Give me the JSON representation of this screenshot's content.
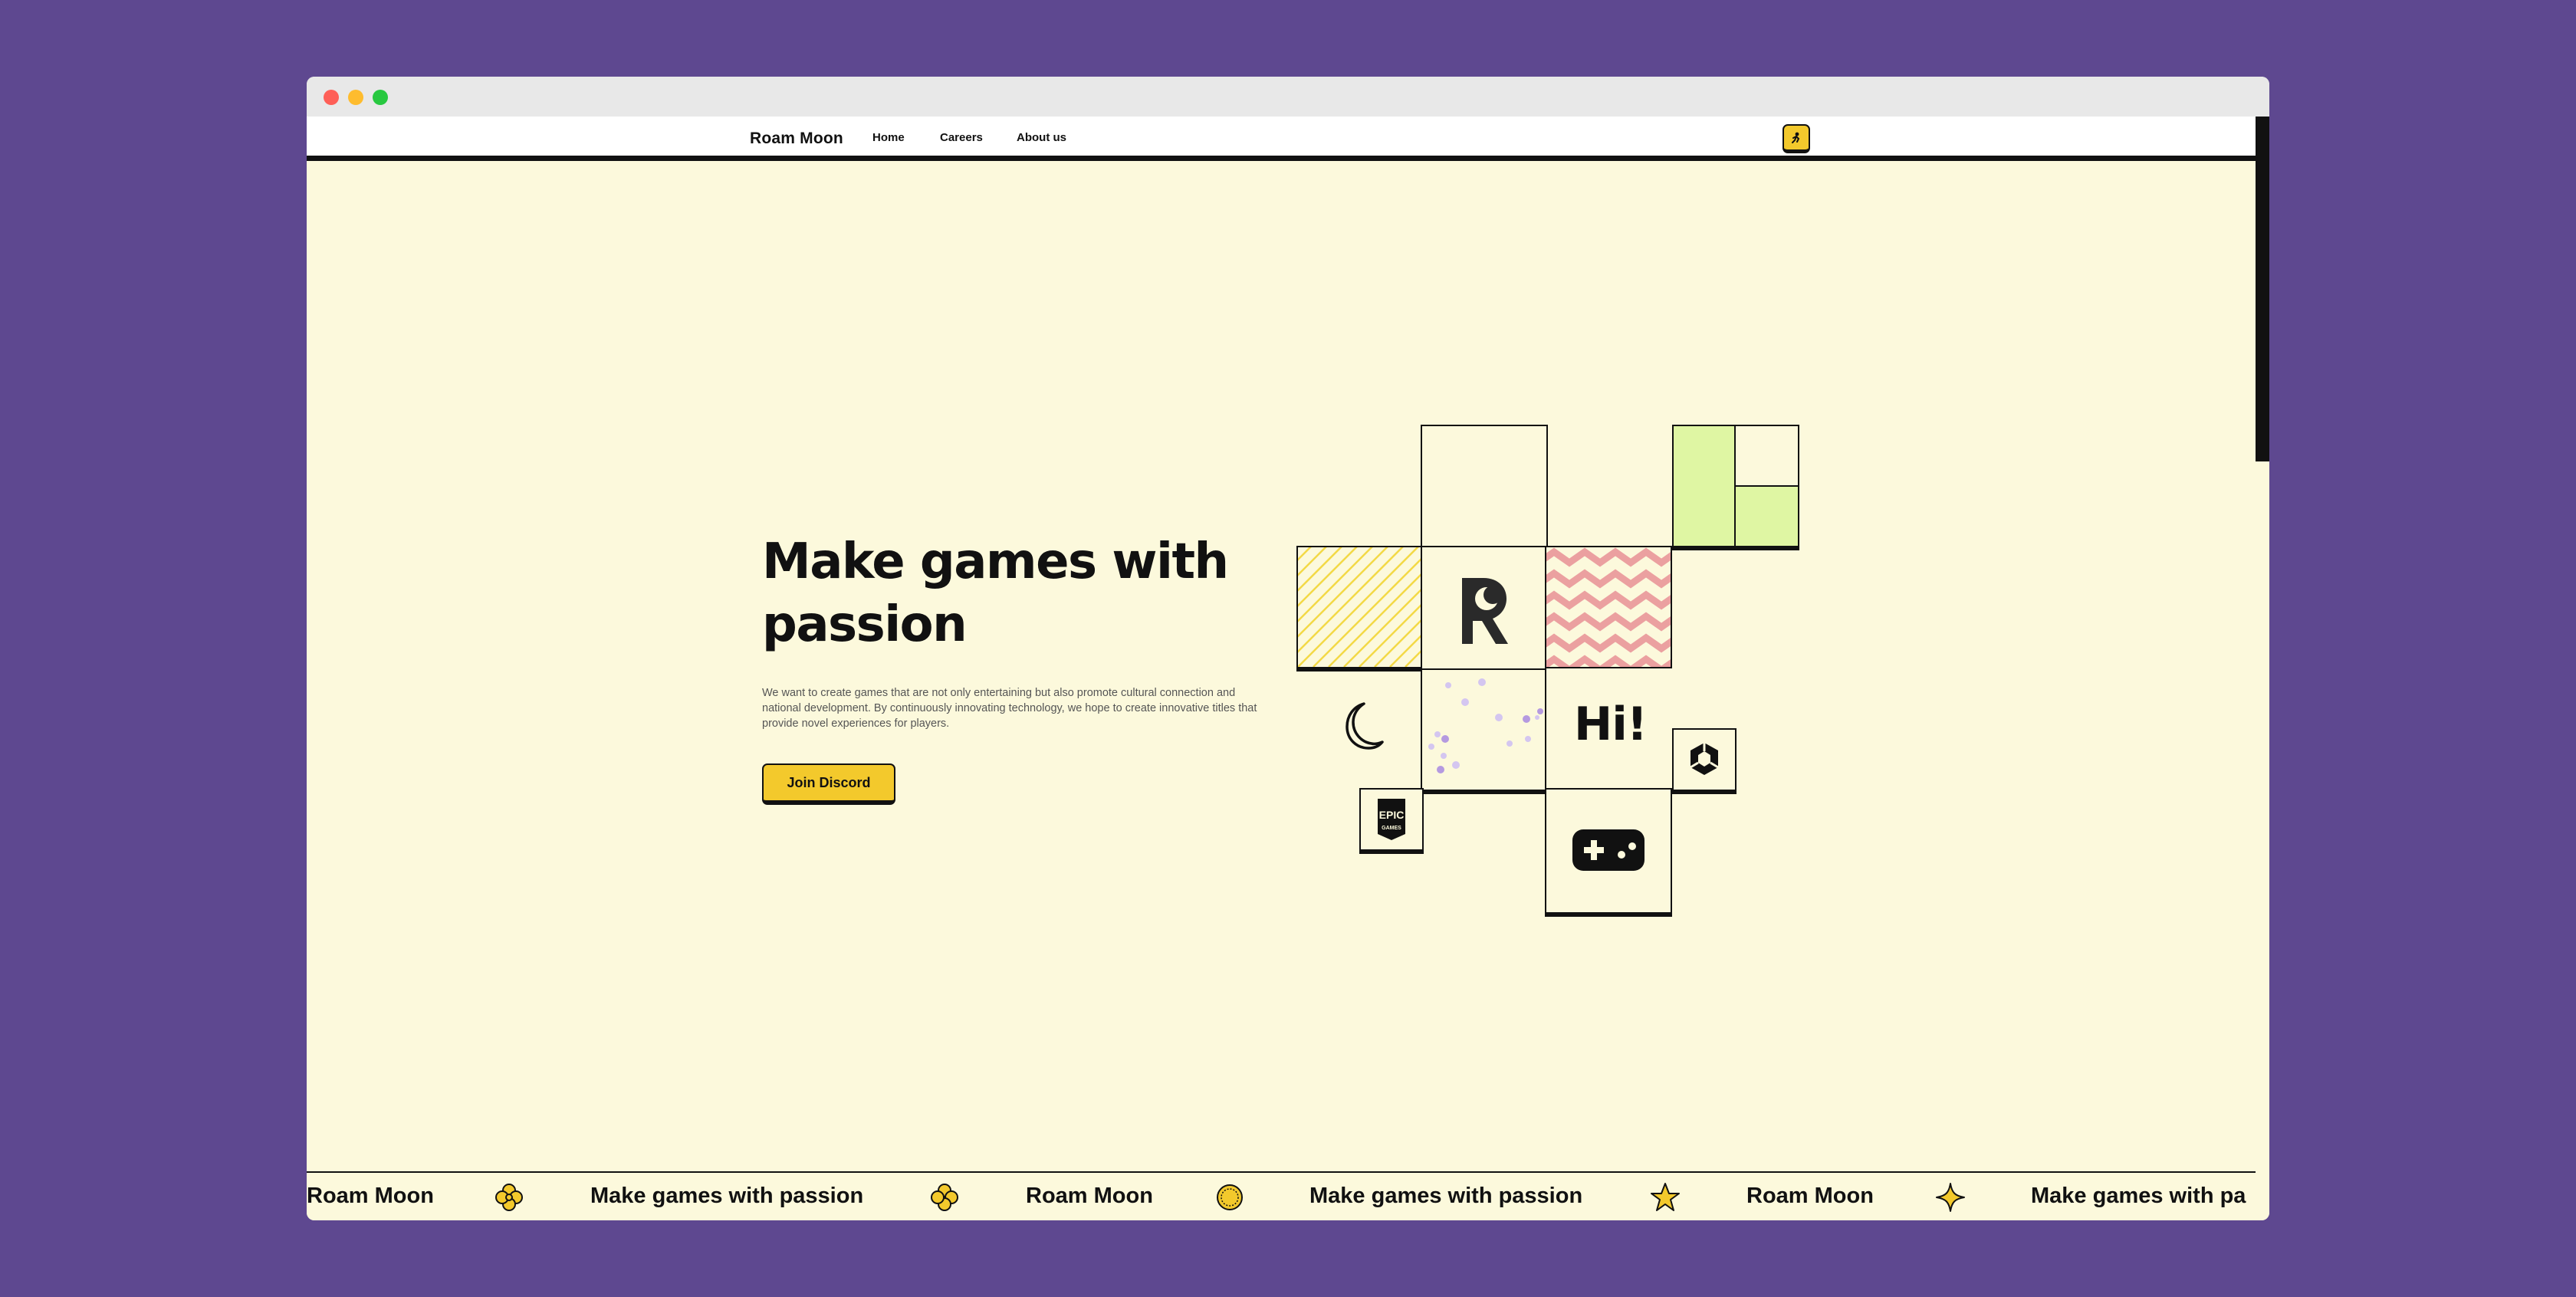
{
  "window": {
    "controls": [
      "close",
      "minimize",
      "maximize"
    ]
  },
  "navbar": {
    "brand": "Roam Moon",
    "links": [
      "Home",
      "Careers",
      "About us"
    ],
    "badge_icon": "moon-runner-icon",
    "accent_color": "#f3c92c"
  },
  "hero": {
    "title": "Make games with passion",
    "description": "We want to create games that are not only entertaining but also promote cultural connection and national development. By continuously innovating technology, we hope to create innovative titles that provide novel experiences for players.",
    "cta_label": "Join Discord"
  },
  "tiles": {
    "logo_icon": "roam-moon-logo-icon",
    "greeting": "Hi!",
    "epic_logo_text": "EPIC GAMES",
    "icons": [
      "diagonal-stripes-pattern",
      "zigzag-pattern",
      "green-grid-pattern",
      "crescent-moon-icon",
      "dots-pattern",
      "unity-icon",
      "epic-games-icon",
      "gamepad-icon"
    ]
  },
  "marquee": {
    "items": [
      "Roam Moon",
      "Make games with passion",
      "Roam Moon",
      "Make games with passion",
      "Roam Moon",
      "Make games with pa"
    ],
    "icons": [
      "flower-icon",
      "flower-icon",
      "sun-icon",
      "star-icon",
      "sparkle-icon"
    ]
  },
  "colors": {
    "background": "#5e4890",
    "page": "#fcf9dc",
    "accent": "#f3c92c",
    "green": "#dff6a3",
    "pink": "#eba0a0"
  }
}
